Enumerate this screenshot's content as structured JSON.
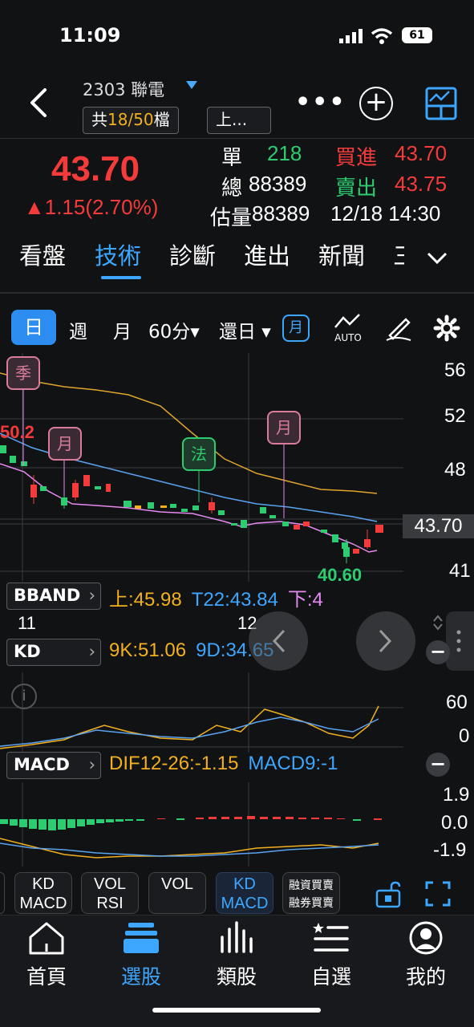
{
  "status": {
    "time": "11:09",
    "battery": "61"
  },
  "header": {
    "stock_title": "2303 聯電",
    "count_prefix": "共",
    "count_value": "18/50",
    "count_suffix": "檔",
    "market_chip": "上..."
  },
  "quote": {
    "price": "43.70",
    "change": "▲1.15(2.70%)",
    "single_label": "單",
    "single_value": "218",
    "total_label": "總",
    "total_value": "88389",
    "est_label": "估量",
    "est_value": "88389",
    "bid_label": "買進",
    "bid_value": "43.70",
    "ask_label": "賣出",
    "ask_value": "43.75",
    "datetime": "12/18 14:30"
  },
  "tabs": [
    {
      "label": "看盤"
    },
    {
      "label": "技術"
    },
    {
      "label": "診斷"
    },
    {
      "label": "進出"
    },
    {
      "label": "新聞"
    },
    {
      "label": "三"
    }
  ],
  "periods": {
    "day": "日",
    "week": "週",
    "month": "月",
    "min60": "60分▾",
    "restore": "還日 ▾",
    "month_box": "月",
    "auto": "AUTO"
  },
  "chart": {
    "y_labels": [
      "56",
      "52",
      "48",
      "41"
    ],
    "current_price": "43.70",
    "high_label": "50.2",
    "low_label": "40.60",
    "markers": [
      "季",
      "月",
      "法",
      "月"
    ],
    "month_labels": [
      "11",
      "12"
    ]
  },
  "indicators": {
    "bband": {
      "name": "BBAND",
      "upper": "上:45.98",
      "mid": "T22:43.84",
      "lower": "下:4"
    },
    "kd": {
      "name": "KD",
      "k": "9K:51.06",
      "d": "9D:34.65",
      "y_labels": [
        "60",
        "0"
      ]
    },
    "macd": {
      "name": "MACD",
      "dif": "DIF12-26:-1.15",
      "macd": "MACD9:-1",
      "y_labels": [
        "1.9",
        "0.0",
        "-1.9"
      ]
    }
  },
  "templates": [
    {
      "l1": "KD",
      "l2": "MACD"
    },
    {
      "l1": "VOL",
      "l2": "RSI"
    },
    {
      "l1": "VOL",
      "l2": ""
    },
    {
      "l1": "KD",
      "l2": "MACD"
    },
    {
      "l1": "融資買賣",
      "l2": "融券買賣"
    }
  ],
  "bottom_nav": [
    {
      "label": "首頁",
      "icon": "home-icon"
    },
    {
      "label": "選股",
      "icon": "stack-icon"
    },
    {
      "label": "類股",
      "icon": "bars-icon"
    },
    {
      "label": "自選",
      "icon": "list-star-icon"
    },
    {
      "label": "我的",
      "icon": "user-icon"
    }
  ],
  "colors": {
    "up": "#f43b3b",
    "down": "#2dcc70",
    "accent": "#3da7ff",
    "ma_month": "#f2b01e",
    "ma_quarter": "#e58af0"
  }
}
